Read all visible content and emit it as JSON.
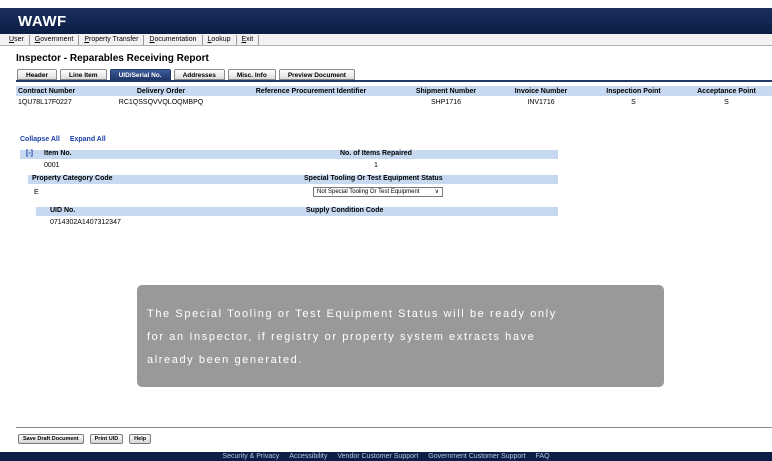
{
  "app": {
    "logo": "WAWF"
  },
  "menu": [
    "User",
    "Government",
    "Property Transfer",
    "Documentation",
    "Lookup",
    "Exit"
  ],
  "page_title": "Inspector - Reparables Receiving Report",
  "tabs": [
    {
      "label": "Header",
      "active": false
    },
    {
      "label": "Line Item",
      "active": false
    },
    {
      "label": "UID/Serial No.",
      "active": true
    },
    {
      "label": "Addresses",
      "active": false
    },
    {
      "label": "Misc. Info",
      "active": false
    },
    {
      "label": "Preview Document",
      "active": false
    }
  ],
  "header_table": {
    "columns": [
      "Contract Number",
      "Delivery Order",
      "Reference Procurement Identifier",
      "Shipment Number",
      "Invoice Number",
      "Inspection Point",
      "Acceptance Point"
    ],
    "row": [
      "1QU78L17F0227",
      "RC1QSSQVVQLOQMBPQ",
      "",
      "SHP1716",
      "INV1716",
      "S",
      "S"
    ]
  },
  "links": {
    "collapse_all": "Collapse All",
    "expand_all": "Expand All"
  },
  "item": {
    "toggle": "[-]",
    "item_no_label": "Item No.",
    "items_repaired_label": "No. of Items Repaired",
    "item_no": "0001",
    "items_repaired": "1"
  },
  "property": {
    "category_label": "Property Category Code",
    "status_label": "Special Tooling Or Test Equipment Status",
    "category": "E",
    "status_selected": "Not Special Tooling Or Test Equipment"
  },
  "uid": {
    "uid_label": "UID No.",
    "supply_label": "Supply Condition Code",
    "uid_value": "0714302A1407312347",
    "supply_value": ""
  },
  "callout": {
    "line1": "The Special Tooling or Test Equipment Status will be ready only",
    "line2": "for an Inspector, if registry or property system extracts have",
    "line3": "already been generated."
  },
  "footer_buttons": [
    "Save Draft Document",
    "Print UID",
    "Help"
  ],
  "bottom_links": [
    "Security & Privacy",
    "Accessibility",
    "Vendor Customer Support",
    "Government Customer Support",
    "FAQ"
  ]
}
